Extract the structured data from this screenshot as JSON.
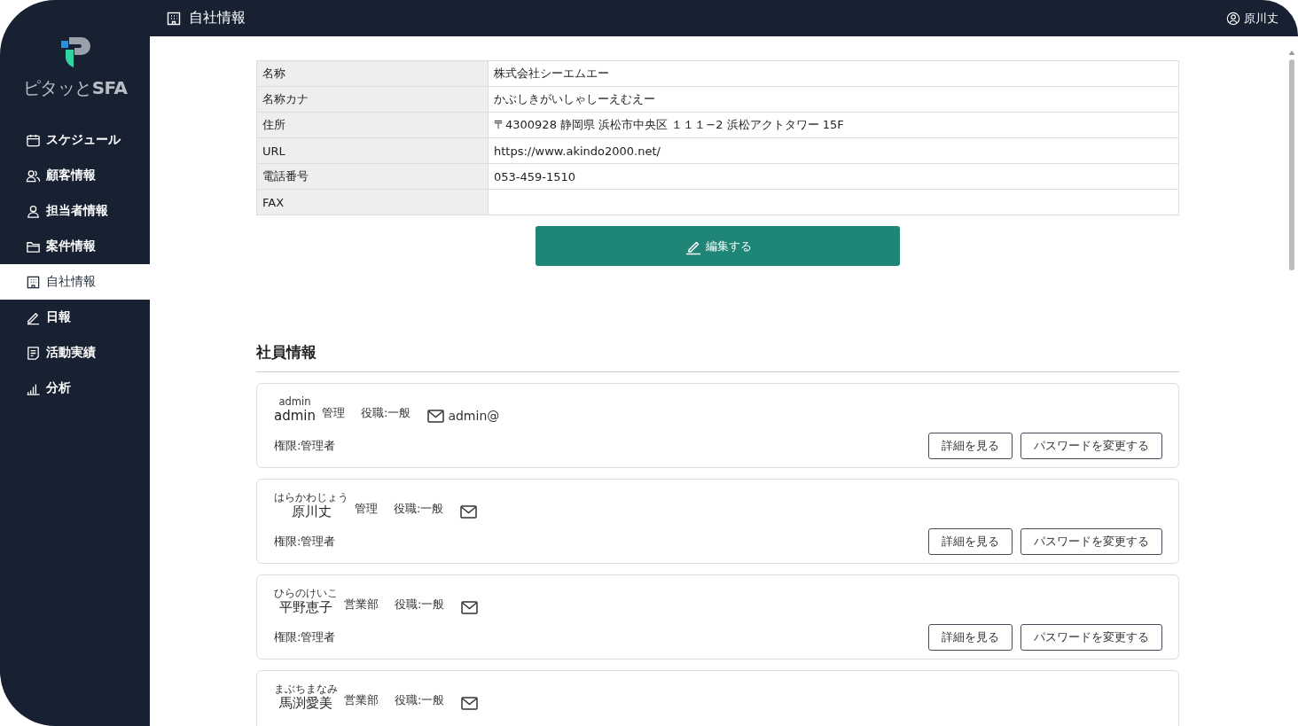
{
  "header": {
    "title": "自社情報",
    "user": "原川丈"
  },
  "logo": {
    "text": "ピタッと**SFA**"
  },
  "sidebar": {
    "items": [
      {
        "label": "スケジュール",
        "selected": false
      },
      {
        "label": "顧客情報",
        "selected": false
      },
      {
        "label": "担当者情報",
        "selected": false
      },
      {
        "label": "案件情報",
        "selected": false
      },
      {
        "label": "自社情報",
        "selected": true
      },
      {
        "label": "日報",
        "selected": false
      },
      {
        "label": "活動実績",
        "selected": false
      },
      {
        "label": "分析",
        "selected": false
      }
    ]
  },
  "company": {
    "rows": [
      {
        "label": "名称",
        "value": "株式会社シーエムエー"
      },
      {
        "label": "名称カナ",
        "value": "かぶしきがいしゃしーえむえー"
      },
      {
        "label": "住所",
        "value": "〒4300928 静岡県 浜松市中央区 １１１−2 浜松アクトタワー 15F"
      },
      {
        "label": "URL",
        "value": "https://www.akindo2000.net/"
      },
      {
        "label": "電話番号",
        "value": "053-459-1510"
      },
      {
        "label": "FAX"
      }
    ],
    "edit_button": "編集する"
  },
  "employees": {
    "title": "社員情報",
    "items": [
      {
        "furigana": "admin",
        "name": "admin",
        "department": "管理",
        "role": "役職:一般",
        "email": "admin@",
        "permission": "権限:管理者",
        "buttons": [
          "詳細を見る",
          "パスワードを変更する"
        ]
      },
      {
        "furigana": "はらかわじょう",
        "name": "原川丈",
        "department": "管理",
        "role": "役職:一般",
        "permission": "権限:管理者",
        "buttons": [
          "詳細を見る",
          "パスワードを変更する"
        ]
      },
      {
        "furigana": "ひらのけいこ",
        "name": "平野恵子",
        "department": "営業部",
        "role": "役職:一般",
        "permission": "権限:管理者",
        "buttons": [
          "詳細を見る",
          "パスワードを変更する"
        ]
      },
      {
        "furigana": "まぶちまなみ",
        "name": "馬渕愛美",
        "department": "営業部",
        "role": "役職:一般"
      }
    ]
  }
}
